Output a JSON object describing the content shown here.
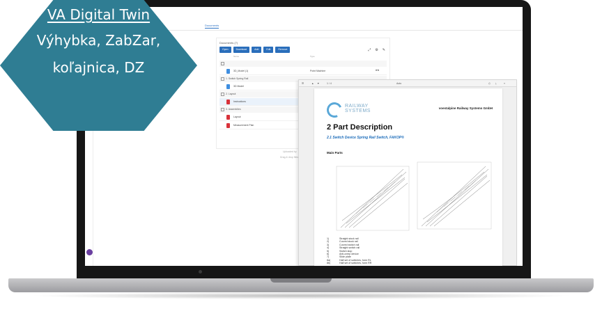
{
  "badge": {
    "title": "VA Digital Twin",
    "subtitle_line1": "Výhybka, ZabZar,",
    "subtitle_line2": "koľajnica, DZ"
  },
  "app": {
    "top_tab": "Documents",
    "panel_title": "Documents (7)",
    "toolbar": [
      "Open",
      "Download",
      "Add",
      "Edit",
      "Remove"
    ],
    "columns": [
      "Name",
      "Type"
    ],
    "groups": [
      {
        "label": "1. Switch Spring Rail"
      },
      {
        "label": "2. Layout"
      },
      {
        "label": "3. Assemblies"
      }
    ],
    "rows": [
      {
        "label": "3D_Model (1)",
        "value": "Point Machine"
      },
      {
        "label": "3D Model",
        "value": ""
      },
      {
        "label": "Instructions",
        "value": ""
      },
      {
        "label": "Layout",
        "value": ""
      },
      {
        "label": "Measurement Plan",
        "value": ""
      }
    ],
    "side_notes": [
      "Uploaded by",
      "Drag & drop files"
    ]
  },
  "pdf": {
    "toolbar_page": "1 / 4",
    "toolbar_zoom": "Auto",
    "logo_text": "RAILWAY SYSTEMS",
    "company": "voestalpine Railway Systems GmbH",
    "heading": "2 Part Description",
    "subheading": "2.1  Switch Device Spring Rail Switch, FAKOP®",
    "main_parts": "Main Parts",
    "legend": [
      {
        "n": "1)",
        "t": "Straight stock rail"
      },
      {
        "n": "2)",
        "t": "Curved stock rail"
      },
      {
        "n": "3)",
        "t": "Curved switch rail"
      },
      {
        "n": "4)",
        "t": "Straight switch rail"
      },
      {
        "n": "5)",
        "t": "Switch stop"
      },
      {
        "n": "6)",
        "t": "Anti-creep device"
      },
      {
        "n": "7)",
        "t": "Slide plate"
      },
      {
        "n": "8a)",
        "t": "Half set of switches, form RL"
      },
      {
        "n": "8b)",
        "t": "Half set of switches, form RR"
      }
    ]
  },
  "colors": {
    "badge": "#2f7d93",
    "accent": "#2a6ebb",
    "pdf_blue": "#1c6cba"
  }
}
